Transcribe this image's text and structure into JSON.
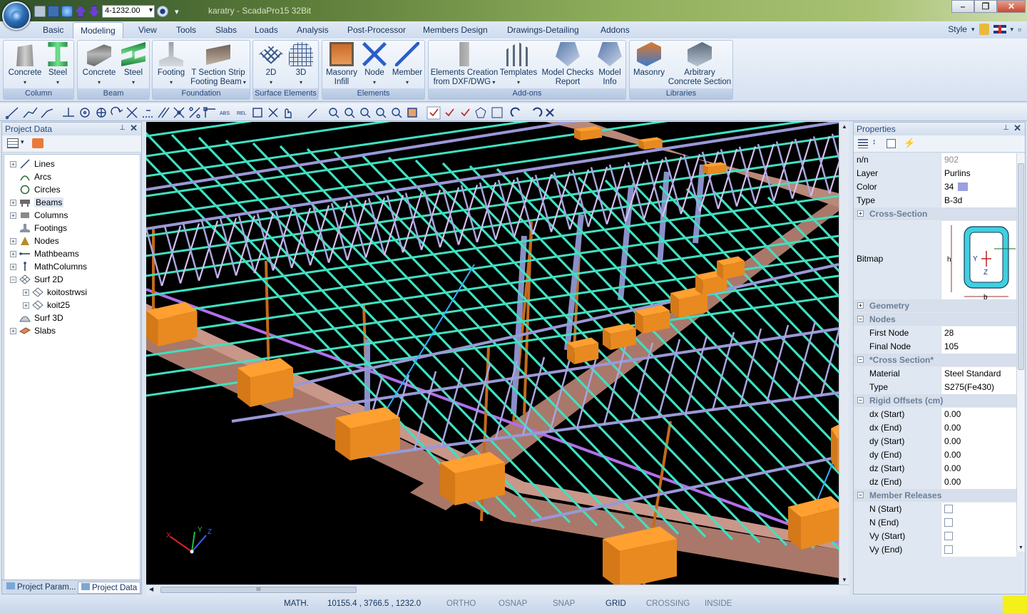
{
  "window": {
    "title": "karatry - ScadaPro15 32Bit",
    "coord_combo": "4-1232.00"
  },
  "ribbon_tabs": [
    "Basic",
    "Modeling",
    "View",
    "Tools",
    "Slabs",
    "Loads",
    "Analysis",
    "Post-Processor",
    "Members Design",
    "Drawings-Detailing",
    "Addons"
  ],
  "active_tab": "Modeling",
  "style_menu": "Style",
  "groups": {
    "column": {
      "title": "Column",
      "b1": "Concrete",
      "b2": "Steel"
    },
    "beam": {
      "title": "Beam",
      "b1": "Concrete",
      "b2": "Steel"
    },
    "foundation": {
      "title": "Foundation",
      "b1": "Footing",
      "b2_l1": "T Section Strip",
      "b2_l2": "Footing Beam"
    },
    "surface": {
      "title": "Surface Elements",
      "b1": "2D",
      "b2": "3D"
    },
    "elements": {
      "title": "Elements",
      "b1_l1": "Masonry",
      "b1_l2": "Infill",
      "b2": "Node",
      "b3": "Member"
    },
    "addons": {
      "title": "Add-ons",
      "b1_l1": "Elements Creation",
      "b1_l2": "from DXF/DWG",
      "b2": "Templates",
      "b3_l1": "Model Checks",
      "b3_l2": "Report",
      "b4_l1": "Model",
      "b4_l2": "Info"
    },
    "libraries": {
      "title": "Libraries",
      "b1": "Masonry",
      "b2_l1": "Arbitrary",
      "b2_l2": "Concrete Section"
    }
  },
  "project_data": {
    "title": "Project Data",
    "tree": [
      {
        "label": "Lines",
        "icon": "line-icon"
      },
      {
        "label": "Arcs",
        "icon": "arc-icon"
      },
      {
        "label": "Circles",
        "icon": "circle-icon"
      },
      {
        "label": "Beams",
        "icon": "beam-icon"
      },
      {
        "label": "Columns",
        "icon": "column-icon"
      },
      {
        "label": "Footings",
        "icon": "footing-icon"
      },
      {
        "label": "Nodes",
        "icon": "node-icon"
      },
      {
        "label": "Mathbeams",
        "icon": "mathbeam-icon"
      },
      {
        "label": "MathColumns",
        "icon": "mathcolumn-icon"
      },
      {
        "label": "Surf 2D",
        "icon": "surface-2d-icon"
      },
      {
        "label": "koitostrwsi",
        "icon": "surface-2d-icon"
      },
      {
        "label": "koit25",
        "icon": "surface-2d-icon"
      },
      {
        "label": "Surf 3D",
        "icon": "surface-3d-icon"
      },
      {
        "label": "Slabs",
        "icon": "slab-icon"
      }
    ],
    "tab1": "Project Param...",
    "tab2": "Project Data"
  },
  "properties": {
    "title": "Properties",
    "nn": {
      "k": "n/n",
      "v": "902"
    },
    "layer": {
      "k": "Layer",
      "v": "Purlins"
    },
    "color": {
      "k": "Color",
      "v": "34",
      "swatch": "#9aa0e0"
    },
    "type": {
      "k": "Type",
      "v": "B-3d"
    },
    "cat_cross": "Cross-Section",
    "bitmap": "Bitmap",
    "bitmap_h": "h",
    "bitmap_b": "b",
    "bitmap_y": "Y",
    "bitmap_z": "Z",
    "cat_geometry": "Geometry",
    "cat_nodes": "Nodes",
    "first_node": {
      "k": "First Node",
      "v": "28"
    },
    "final_node": {
      "k": "Final Node",
      "v": "105"
    },
    "cat_cross2": "*Cross Section*",
    "material": {
      "k": "Material",
      "v": "Steel Standard"
    },
    "type2": {
      "k": "Type",
      "v": "S275(Fe430)"
    },
    "cat_rigid": "Rigid Offsets (cm)",
    "offsets": [
      {
        "k": "dx (Start)",
        "v": "0.00"
      },
      {
        "k": "dx (End)",
        "v": "0.00"
      },
      {
        "k": "dy (Start)",
        "v": "0.00"
      },
      {
        "k": "dy (End)",
        "v": "0.00"
      },
      {
        "k": "dz (Start)",
        "v": "0.00"
      },
      {
        "k": "dz (End)",
        "v": "0.00"
      }
    ],
    "cat_releases": "Member Releases",
    "releases": [
      {
        "k": "N (Start)",
        "checked": false
      },
      {
        "k": "N (End)",
        "checked": false
      },
      {
        "k": "Vy (Start)",
        "checked": false
      },
      {
        "k": "Vy (End)",
        "checked": false
      }
    ]
  },
  "viewport": {
    "axis_x": "X",
    "axis_y": "Y",
    "axis_z": "Z"
  },
  "status": {
    "math": "MATH.",
    "coords": "10155.4 , 3766.5 , 1232.0",
    "ortho": "ORTHO",
    "osnap": "OSNAP",
    "snap": "SNAP",
    "grid": "GRID",
    "crossing": "CROSSING",
    "inside": "INSIDE"
  },
  "hscroll_thumb": "III"
}
